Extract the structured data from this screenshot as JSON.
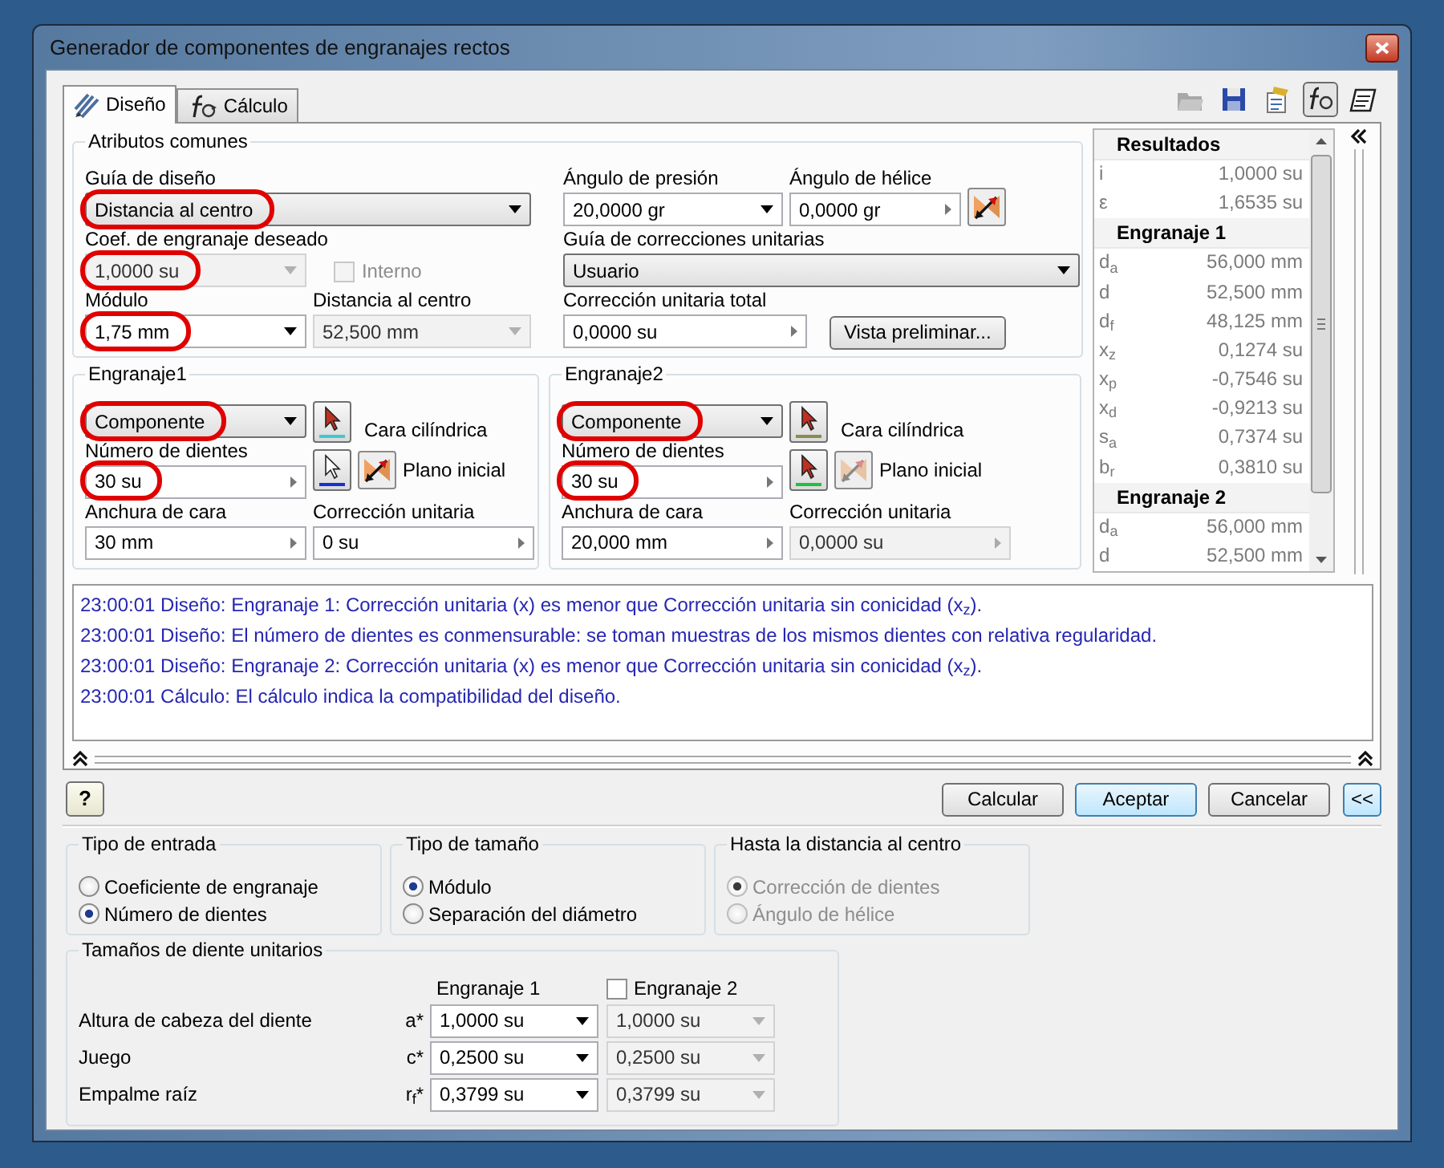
{
  "window": {
    "title": "Generador de componentes de engranajes rectos"
  },
  "tabs": [
    {
      "label": "Diseño",
      "selected": true
    },
    {
      "label": "Cálculo",
      "selected": false
    }
  ],
  "common": {
    "title": "Atributos comunes",
    "design_guide": {
      "label": "Guía de diseño",
      "value": "Distancia al centro",
      "kind": "select",
      "disabled": false,
      "highlighted": true
    },
    "ratio": {
      "label": "Coef. de engranaje deseado",
      "value": "1,0000 su",
      "kind": "combo",
      "disabled": true,
      "highlighted": true
    },
    "internal": {
      "label": "Interno",
      "checked": false,
      "disabled": true
    },
    "module": {
      "label": "Módulo",
      "value": "1,75 mm",
      "kind": "combo",
      "disabled": false,
      "highlighted": true
    },
    "center_distance": {
      "label": "Distancia al centro",
      "value": "52,500 mm",
      "kind": "combo",
      "disabled": true,
      "highlighted": false
    },
    "pressure_angle": {
      "label": "Ángulo de presión",
      "value": "20,0000 gr",
      "kind": "combo",
      "disabled": false,
      "highlighted": false
    },
    "helix_angle": {
      "label": "Ángulo de hélice",
      "value": "0,0000 gr",
      "kind": "spin",
      "disabled": false,
      "highlighted": false
    },
    "correction_guide": {
      "label": "Guía de correcciones unitarias",
      "value": "Usuario",
      "kind": "select",
      "disabled": false,
      "highlighted": false
    },
    "total_correction": {
      "label": "Corrección unitaria total",
      "value": "0,0000 su",
      "kind": "spin",
      "disabled": false,
      "highlighted": false
    },
    "preview_button": "Vista preliminar..."
  },
  "gears": [
    {
      "title": "Engranaje1",
      "type": {
        "value": "Componente",
        "kind": "select",
        "disabled": false,
        "highlighted": true
      },
      "cylinder_face": {
        "label": "Cara cilíndrica",
        "color": "#40c8d0"
      },
      "start_plane": {
        "label": "Plano inicial",
        "color": "#1a2fd0",
        "flip_disabled": false
      },
      "teeth": {
        "label": "Número de dientes",
        "value": "30 su",
        "kind": "spin",
        "disabled": false,
        "highlighted": true
      },
      "face_width": {
        "label": "Anchura de cara",
        "value": "30 mm",
        "kind": "spin",
        "disabled": false,
        "highlighted": false
      },
      "correction": {
        "label": "Corrección unitaria",
        "value": "0 su",
        "kind": "spin",
        "disabled": false,
        "highlighted": false
      }
    },
    {
      "title": "Engranaje2",
      "type": {
        "value": "Componente",
        "kind": "select",
        "disabled": false,
        "highlighted": true
      },
      "cylinder_face": {
        "label": "Cara cilíndrica",
        "color": "#8c8a50"
      },
      "start_plane": {
        "label": "Plano inicial",
        "color": "#20c040",
        "flip_disabled": true
      },
      "teeth": {
        "label": "Número de dientes",
        "value": "30 su",
        "kind": "spin",
        "disabled": false,
        "highlighted": true
      },
      "face_width": {
        "label": "Anchura de cara",
        "value": "20,000 mm",
        "kind": "spin",
        "disabled": false,
        "highlighted": false
      },
      "correction": {
        "label": "Corrección unitaria",
        "value": "0,0000 su",
        "kind": "spin",
        "disabled": true,
        "highlighted": false
      }
    }
  ],
  "results": {
    "title": "Resultados",
    "sections": [
      {
        "rows": [
          {
            "symbol": "i",
            "value": "1,0000 su"
          },
          {
            "symbol": "ε",
            "value": "1,6535 su"
          }
        ]
      },
      {
        "heading": "Engranaje 1",
        "rows": [
          {
            "symbol": "d$_{a}$",
            "value": "56,000 mm"
          },
          {
            "symbol": "d",
            "value": "52,500 mm"
          },
          {
            "symbol": "d$_{f}$",
            "value": "48,125 mm"
          },
          {
            "symbol": "x$_{z}$",
            "value": "0,1274 su"
          },
          {
            "symbol": "x$_{p}$",
            "value": "-0,7546 su"
          },
          {
            "symbol": "x$_{d}$",
            "value": "-0,9213 su"
          },
          {
            "symbol": "s$_{a}$",
            "value": "0,7374 su"
          },
          {
            "symbol": "b$_{r}$",
            "value": "0,3810 su"
          }
        ]
      },
      {
        "heading": "Engranaje 2",
        "rows": [
          {
            "symbol": "d$_{a}$",
            "value": "56,000 mm"
          },
          {
            "symbol": "d",
            "value": "52,500 mm"
          }
        ]
      }
    ]
  },
  "messages": [
    "23:00:01 Diseño: Engranaje 1: Corrección unitaria (x) es menor que Corrección unitaria sin conicidad (x$_{z}$).",
    "23:00:01 Diseño: El número de dientes es conmensurable: se toman muestras de los mismos dientes con relativa regularidad.",
    "23:00:01 Diseño: Engranaje 2: Corrección unitaria (x) es menor que Corrección unitaria sin conicidad (x$_{z}$).",
    "23:00:01 Cálculo: El cálculo indica la compatibilidad del diseño."
  ],
  "help": "?",
  "buttons": [
    {
      "label": "Calcular",
      "default": false
    },
    {
      "label": "Aceptar",
      "default": true
    },
    {
      "label": "Cancelar",
      "default": false
    }
  ],
  "collapse_button": "<<",
  "option_groups": [
    {
      "title": "Tipo de entrada",
      "options": [
        {
          "label": "Coeficiente de engranaje",
          "selected": false,
          "disabled": false
        },
        {
          "label": "Número de dientes",
          "selected": true,
          "disabled": false
        }
      ]
    },
    {
      "title": "Tipo de tamaño",
      "options": [
        {
          "label": "Módulo",
          "selected": true,
          "disabled": false
        },
        {
          "label": "Separación del diámetro",
          "selected": false,
          "disabled": false
        }
      ]
    },
    {
      "title": "Hasta la distancia al centro",
      "options": [
        {
          "label": "Corrección de dientes",
          "selected": true,
          "disabled": true
        },
        {
          "label": "Ángulo de hélice",
          "selected": false,
          "disabled": true
        }
      ]
    }
  ],
  "tooth_sizes": {
    "title": "Tamaños de diente unitarios",
    "column_1": "Engranaje 1",
    "gear_2_toggle": {
      "label": "Engranaje 2",
      "checked": false,
      "disabled": false
    },
    "rows": [
      {
        "label": "Altura de cabeza del diente",
        "symbol": "a*",
        "gear_1": {
          "value": "1,0000 su",
          "kind": "combo",
          "disabled": false
        },
        "gear_2": {
          "value": "1,0000 su",
          "kind": "combo",
          "disabled": true
        }
      },
      {
        "label": "Juego",
        "symbol": "c*",
        "gear_1": {
          "value": "0,2500 su",
          "kind": "combo",
          "disabled": false
        },
        "gear_2": {
          "value": "0,2500 su",
          "kind": "combo",
          "disabled": true
        }
      },
      {
        "label": "Empalme raíz",
        "symbol": "r$_{f}$*",
        "gear_1": {
          "value": "0,3799 su",
          "kind": "combo",
          "disabled": false
        },
        "gear_2": {
          "value": "0,3799 su",
          "kind": "combo",
          "disabled": true
        }
      }
    ]
  }
}
